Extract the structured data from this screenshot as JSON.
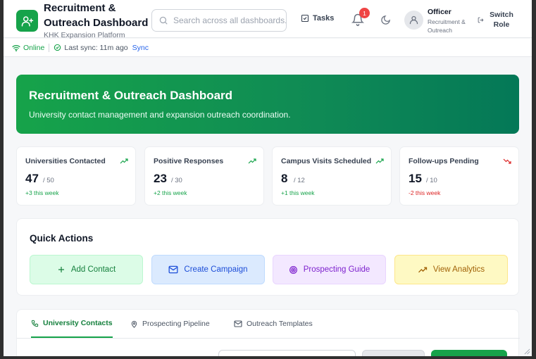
{
  "header": {
    "title": "Recruitment & Outreach Dashboard",
    "subtitle": "KHK Expansion Platform",
    "search_placeholder": "Search across all dashboards...",
    "tasks_label": "Tasks",
    "notification_count": "1",
    "user_role": "Officer",
    "user_dept": "Recruitment & Outreach",
    "switch_role_label": "Switch Role"
  },
  "status": {
    "online": "Online",
    "last_sync": "Last sync: 11m ago",
    "sync_link": "Sync"
  },
  "hero": {
    "title": "Recruitment & Outreach Dashboard",
    "subtitle": "University contact management and expansion outreach coordination."
  },
  "stats": [
    {
      "label": "Universities Contacted",
      "value": "47",
      "total": "/ 50",
      "delta": "+3 this week",
      "trend": "up"
    },
    {
      "label": "Positive Responses",
      "value": "23",
      "total": "/ 30",
      "delta": "+2 this week",
      "trend": "up"
    },
    {
      "label": "Campus Visits Scheduled",
      "value": "8",
      "total": "/ 12",
      "delta": "+1 this week",
      "trend": "up"
    },
    {
      "label": "Follow-ups Pending",
      "value": "15",
      "total": "/ 10",
      "delta": "-2 this week",
      "trend": "down"
    }
  ],
  "quick_actions": {
    "title": "Quick Actions",
    "buttons": [
      {
        "label": "Add Contact",
        "icon": "plus-icon"
      },
      {
        "label": "Create Campaign",
        "icon": "mail-icon"
      },
      {
        "label": "Prospecting Guide",
        "icon": "target-icon"
      },
      {
        "label": "View Analytics",
        "icon": "trending-up-icon"
      }
    ]
  },
  "tabs": [
    {
      "label": "University Contacts",
      "icon": "phone-icon",
      "active": true
    },
    {
      "label": "Prospecting Pipeline",
      "icon": "map-pin-icon",
      "active": false
    },
    {
      "label": "Outreach Templates",
      "icon": "mail-icon",
      "active": false
    }
  ],
  "colors": {
    "brand": "#16a34a",
    "positive": "#16a34a",
    "negative": "#dc2626",
    "link": "#2563eb"
  }
}
